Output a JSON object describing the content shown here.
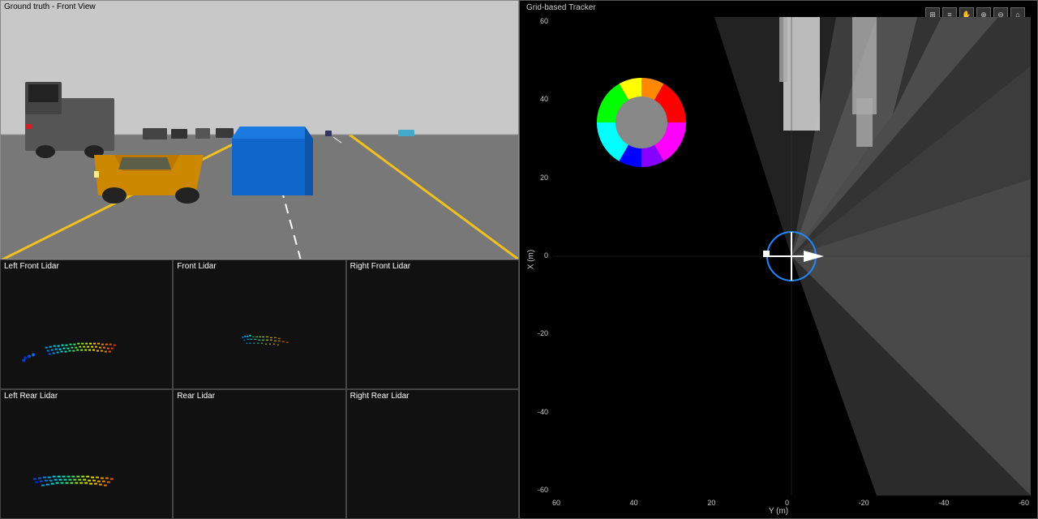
{
  "leftPanel": {
    "frontView": {
      "title": "Ground truth - Front View"
    },
    "lidarCells": [
      {
        "id": "left-front-lidar",
        "title": "Left Front Lidar",
        "row": 1,
        "col": 1
      },
      {
        "id": "front-lidar",
        "title": "Front Lidar",
        "row": 1,
        "col": 2
      },
      {
        "id": "right-front-lidar",
        "title": "Right Front Lidar",
        "row": 1,
        "col": 3
      },
      {
        "id": "left-rear-lidar",
        "title": "Left Rear Lidar",
        "row": 2,
        "col": 1
      },
      {
        "id": "rear-lidar",
        "title": "Rear Lidar",
        "row": 2,
        "col": 2
      },
      {
        "id": "right-rear-lidar",
        "title": "Right Rear Lidar",
        "row": 2,
        "col": 3
      }
    ]
  },
  "rightPanel": {
    "title": "Grid-based Tracker",
    "yAxisLabels": [
      "60",
      "40",
      "20",
      "0",
      "-20",
      "-40",
      "-60"
    ],
    "xAxisLabels": [
      "60",
      "40",
      "20",
      "0",
      "-20",
      "-40",
      "-60"
    ],
    "xAxisName": "Y (m)",
    "yAxisName": "X (m)",
    "toolbar": {
      "buttons": [
        "⊞",
        "≡",
        "✋",
        "⊖",
        "⊕",
        "⌂"
      ]
    }
  }
}
